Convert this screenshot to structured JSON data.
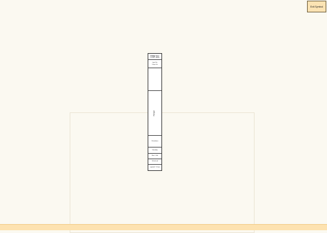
{
  "toolbar": {
    "exit_label": "Exit Symbol"
  },
  "symbol": {
    "header_title": "Filter Inc",
    "header_sub": "SYMBOL NAME",
    "section1_line1": "Input Var",
    "section1_line2": "Output Var",
    "section2_label": "",
    "section3_label": "Plunger",
    "section4_label": "Shutdown",
    "section5_label": "Standby",
    "section6_label": "Run / Idle",
    "section7_label": "Unlocked",
    "section8_label": "SHORT TITLE"
  },
  "colors": {
    "background": "#fbf9f1",
    "bottom_bar": "#fde2b0",
    "exit_button": "#fbe3b3"
  }
}
